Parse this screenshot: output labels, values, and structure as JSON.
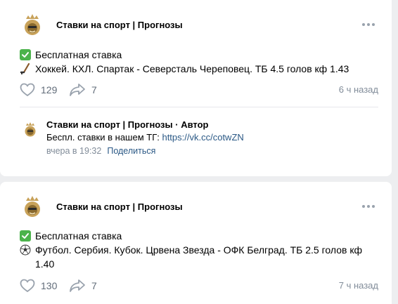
{
  "posts": [
    {
      "group_name": "Ставки на спорт | Прогнозы",
      "badge_text": "Бесплатная ставка",
      "event_text": "Хоккей. КХЛ. Спартак - Северсталь Череповец. ТБ 4.5 голов кф 1.43",
      "event_icon": "hockey-stick-icon",
      "likes": "129",
      "shares": "7",
      "time": "6 ч назад",
      "comment": {
        "author": "Ставки на спорт | Прогнозы",
        "role": " · Автор",
        "text_prefix": "Беспл. ставки в нашем ТГ: ",
        "link": "https://vk.cc/cotwZN",
        "time": "вчера в 19:32",
        "share_label": "Поделиться"
      }
    },
    {
      "group_name": "Ставки на спорт | Прогнозы",
      "badge_text": "Бесплатная ставка",
      "event_text": "Футбол. Сербия. Кубок. Црвена Звезда - ОФК Белград. ТБ 2.5 голов кф 1.40",
      "event_icon": "soccer-ball-icon",
      "likes": "130",
      "shares": "7",
      "time": "7 ч назад"
    }
  ],
  "colors": {
    "background": "#edeef0",
    "card": "#ffffff",
    "check_green": "#4bb34b",
    "link_blue": "#2a5885",
    "muted": "#818c99",
    "avatar_gold": "#c8a25a"
  }
}
